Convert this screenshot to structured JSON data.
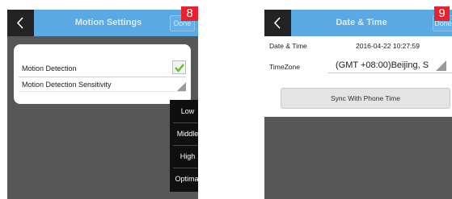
{
  "left_screen": {
    "title": "Motion Settings",
    "done_label": "Done",
    "step_number": "8",
    "rows": {
      "motion_detection": "Motion Detection",
      "sensitivity": "Motion Detection Sensitivity"
    },
    "motion_detection_checked": true,
    "sensitivity_options": [
      "Low",
      "Middle",
      "High",
      "Optimal"
    ]
  },
  "right_screen": {
    "title": "Date & Time",
    "done_label": "Done",
    "step_number": "9",
    "date_time_label": "Date & Time",
    "date_time_value": "2016-04-22 10:27:59",
    "timezone_label": "TimeZone",
    "timezone_value": "(GMT +08:00)Beijing, S",
    "sync_button_label": "Sync With Phone Time"
  },
  "colors": {
    "titlebar": "#5aa9e2",
    "back_button": "#232323",
    "background": "#575757",
    "badge": "#e8212b",
    "checkmark": "#6dbb2b"
  }
}
